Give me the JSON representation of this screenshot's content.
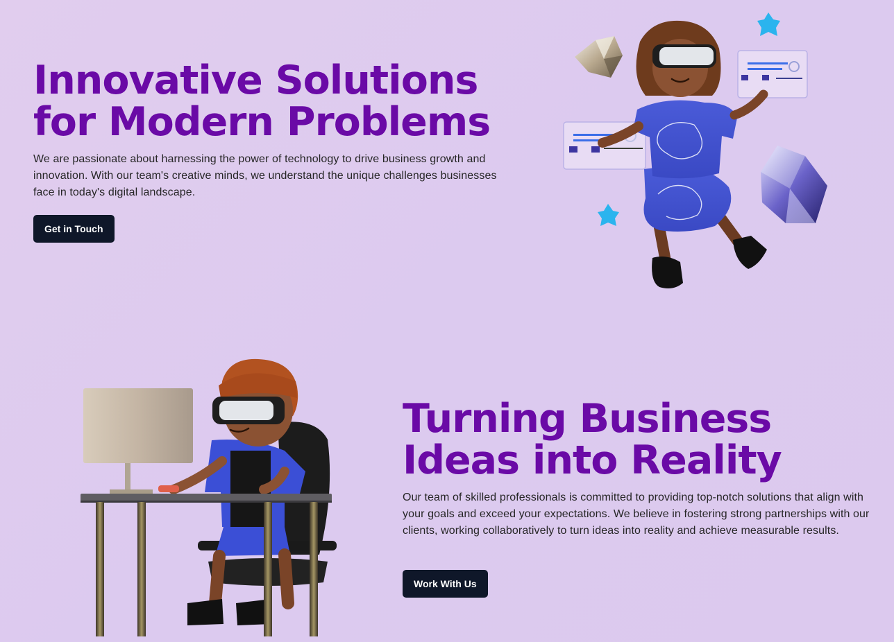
{
  "hero": {
    "title_line1": "Innovative Solutions",
    "title_line2": "for Modern Problems",
    "description": "We are passionate about harnessing the power of technology to drive business growth and innovation. With our team's creative minds, we understand the unique challenges businesses face in today's digital landscape.",
    "button_label": "Get in Touch",
    "illustration": "vr-girl-floating-illustration"
  },
  "second": {
    "title_line1": "Turning Business",
    "title_line2": "Ideas into Reality",
    "description": "Our team of skilled professionals is committed to providing top-notch solutions that align with your goals and exceed your expectations. We believe in fostering strong partnerships with our clients, working collaboratively to turn ideas into reality and achieve measurable results.",
    "button_label": "Work With Us",
    "illustration": "vr-boy-at-desk-illustration"
  },
  "colors": {
    "background": "#dccaef",
    "heading": "#6a0aa6",
    "button": "#0f1729",
    "body_text": "#262626"
  }
}
